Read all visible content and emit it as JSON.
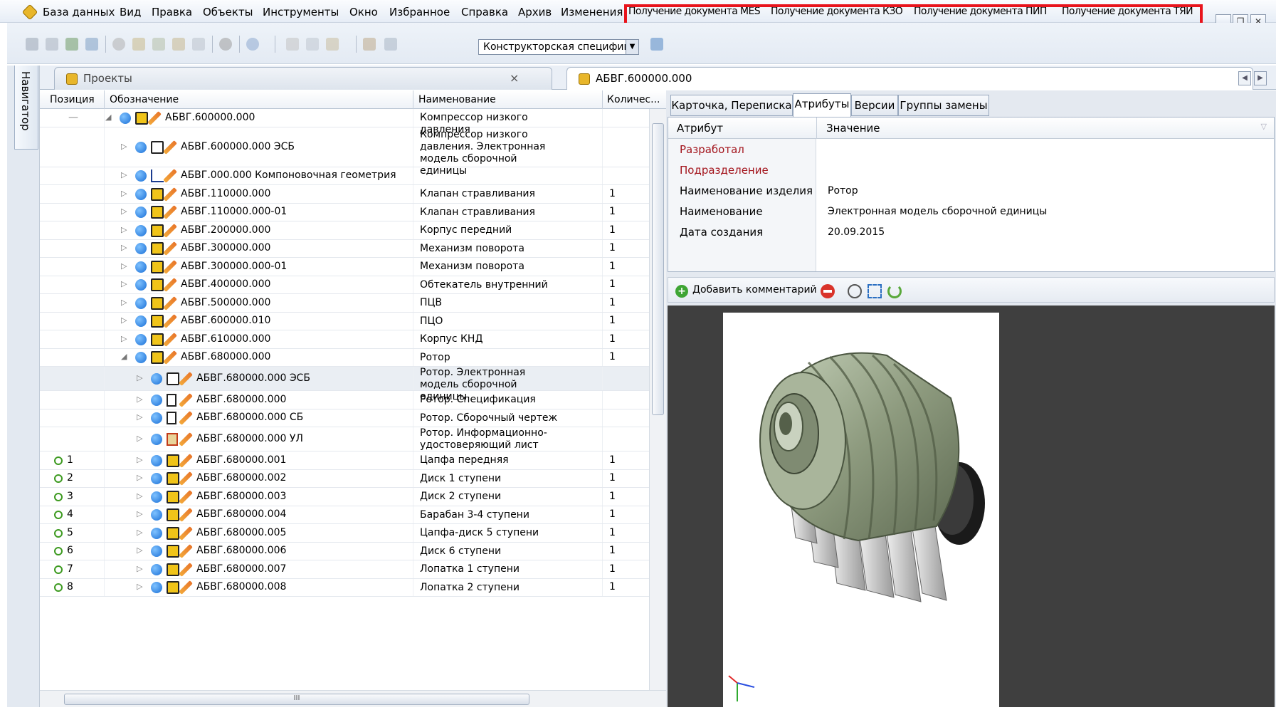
{
  "menu": {
    "items": [
      "База данных",
      "Вид",
      "Правка",
      "Объекты",
      "Инструменты",
      "Окно",
      "Избранное",
      "Справка",
      "Архив",
      "Изменения"
    ],
    "custom_items": [
      "Получение документа MES",
      "Получение документа КЗО",
      "Получение документа ПИП",
      "Получение документа ТЯИ"
    ]
  },
  "window_controls": {
    "minimize": "_",
    "restore": "❐",
    "close": "✕"
  },
  "toolbar": {
    "spec_combo_value": "Конструкторская специфик",
    "icons": [
      "new-icon",
      "tree-icon",
      "calendar-icon",
      "mail-icon",
      "info-icon",
      "key-icon",
      "check-icon",
      "star-icon",
      "frame-icon",
      "stop-icon",
      "search-icon",
      "cut-icon",
      "copy-icon",
      "paste-icon",
      "edit-icon",
      "report-icon",
      "settings-icon"
    ]
  },
  "navigator": {
    "label": "Навигатор"
  },
  "doc_tabs": [
    {
      "label": "Проекты",
      "active": false
    },
    {
      "label": "АБВГ.600000.000",
      "active": true
    }
  ],
  "tab_close": "×",
  "grid": {
    "headers": [
      "Позиция",
      "Обозначение",
      "Наименование",
      "Количес..."
    ],
    "rows": [
      {
        "pos": "—",
        "code": "АБВГ.600000.000",
        "name": "Компрессор низкого давления",
        "qty": "",
        "level": 0,
        "icon": "assembly",
        "expanded": true
      },
      {
        "pos": "",
        "code": "АБВГ.600000.000 ЭСБ",
        "name": "Компрессор низкого давления. Электронная модель сборочной единицы",
        "qty": "",
        "level": 1,
        "icon": "model"
      },
      {
        "pos": "",
        "code": "АБВГ.000.000 Компоновочная геометрия",
        "name": "",
        "qty": "",
        "level": 1,
        "icon": "geometry"
      },
      {
        "pos": "",
        "code": "АБВГ.110000.000",
        "name": "Клапан стравливания",
        "qty": "1",
        "level": 1,
        "icon": "assembly"
      },
      {
        "pos": "",
        "code": "АБВГ.110000.000-01",
        "name": "Клапан стравливания",
        "qty": "1",
        "level": 1,
        "icon": "assembly"
      },
      {
        "pos": "",
        "code": "АБВГ.200000.000",
        "name": "Корпус передний",
        "qty": "1",
        "level": 1,
        "icon": "assembly"
      },
      {
        "pos": "",
        "code": "АБВГ.300000.000",
        "name": "Механизм поворота",
        "qty": "1",
        "level": 1,
        "icon": "assembly"
      },
      {
        "pos": "",
        "code": "АБВГ.300000.000-01",
        "name": "Механизм поворота",
        "qty": "1",
        "level": 1,
        "icon": "assembly"
      },
      {
        "pos": "",
        "code": "АБВГ.400000.000",
        "name": "Обтекатель внутренний",
        "qty": "1",
        "level": 1,
        "icon": "assembly"
      },
      {
        "pos": "",
        "code": "АБВГ.500000.000",
        "name": "ПЦВ",
        "qty": "1",
        "level": 1,
        "icon": "assembly"
      },
      {
        "pos": "",
        "code": "АБВГ.600000.010",
        "name": "ПЦО",
        "qty": "1",
        "level": 1,
        "icon": "assembly"
      },
      {
        "pos": "",
        "code": "АБВГ.610000.000",
        "name": "Корпус КНД",
        "qty": "1",
        "level": 1,
        "icon": "assembly"
      },
      {
        "pos": "",
        "code": "АБВГ.680000.000",
        "name": "Ротор",
        "qty": "1",
        "level": 1,
        "icon": "assembly",
        "expanded": true
      },
      {
        "pos": "",
        "code": "АБВГ.680000.000 ЭСБ",
        "name": "Ротор. Электронная модель сборочной единицы",
        "qty": "",
        "level": 2,
        "icon": "model",
        "selected": true
      },
      {
        "pos": "",
        "code": "АБВГ.680000.000",
        "name": "Ротор. Спецификация",
        "qty": "",
        "level": 2,
        "icon": "spec"
      },
      {
        "pos": "",
        "code": "АБВГ.680000.000 СБ",
        "name": "Ротор. Сборочный чертеж",
        "qty": "",
        "level": 2,
        "icon": "drawing"
      },
      {
        "pos": "",
        "code": "АБВГ.680000.000 УЛ",
        "name": "Ротор. Информационно-удостоверяющий лист",
        "qty": "",
        "level": 2,
        "icon": "list"
      },
      {
        "pos": "1",
        "code": "АБВГ.680000.001",
        "name": "Цапфа передняя",
        "qty": "1",
        "level": 2,
        "icon": "part"
      },
      {
        "pos": "2",
        "code": "АБВГ.680000.002",
        "name": "Диск 1 ступени",
        "qty": "1",
        "level": 2,
        "icon": "part"
      },
      {
        "pos": "3",
        "code": "АБВГ.680000.003",
        "name": "Диск 2 ступени",
        "qty": "1",
        "level": 2,
        "icon": "part"
      },
      {
        "pos": "4",
        "code": "АБВГ.680000.004",
        "name": "Барабан 3-4 ступени",
        "qty": "1",
        "level": 2,
        "icon": "part"
      },
      {
        "pos": "5",
        "code": "АБВГ.680000.005",
        "name": "Цапфа-диск 5 ступени",
        "qty": "1",
        "level": 2,
        "icon": "part"
      },
      {
        "pos": "6",
        "code": "АБВГ.680000.006",
        "name": "Диск 6 ступени",
        "qty": "1",
        "level": 2,
        "icon": "part"
      },
      {
        "pos": "7",
        "code": "АБВГ.680000.007",
        "name": "Лопатка 1 ступени",
        "qty": "1",
        "level": 2,
        "icon": "part"
      },
      {
        "pos": "8",
        "code": "АБВГ.680000.008",
        "name": "Лопатка 2 ступени",
        "qty": "1",
        "level": 2,
        "icon": "part"
      }
    ]
  },
  "hscroll_grip": "III",
  "right_panel": {
    "tabs": [
      "Карточка, Переписка",
      "Атрибуты",
      "Версии",
      "Группы замены"
    ],
    "active_tab": "Атрибуты",
    "attr_header": {
      "name": "Атрибут",
      "value": "Значение"
    },
    "attributes": [
      {
        "name": "Разработал",
        "value": "",
        "required": true
      },
      {
        "name": "Подразделение",
        "value": "",
        "required": true
      },
      {
        "name": "Наименование изделия",
        "value": "Ротор",
        "required": false
      },
      {
        "name": "Наименование",
        "value": "Электронная модель сборочной единицы",
        "required": false
      },
      {
        "name": "Дата создания",
        "value": "20.09.2015",
        "required": false
      }
    ],
    "comment_button": "Добавить комментарий"
  },
  "colors": {
    "highlight": "#e8141c",
    "required_attr": "#a3141c",
    "viewer_bg": "#3f3f3f"
  }
}
